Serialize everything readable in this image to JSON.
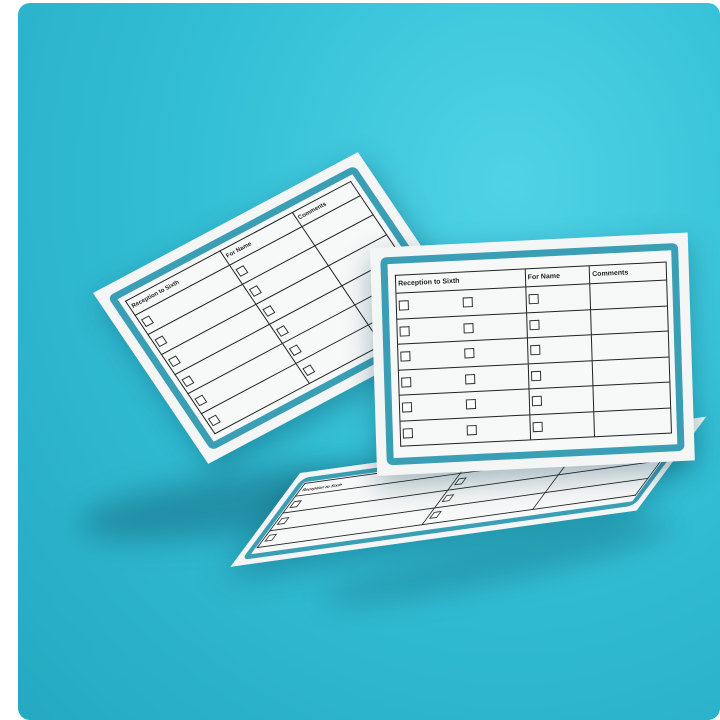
{
  "scene": {
    "description_colors": {
      "background": "#33bfd6",
      "card_border": "#3a9eb5",
      "card_paper": "#f4f5f5"
    }
  },
  "form": {
    "headers": {
      "reception": "Reception to Sixth",
      "for_name": "For Name",
      "comments": "Comments"
    }
  }
}
